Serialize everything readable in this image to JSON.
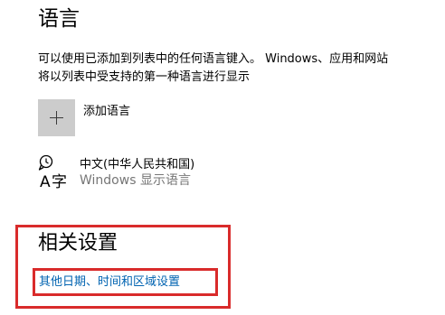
{
  "language_section": {
    "title": "语言",
    "description_line1": "可以使用已添加到列表中的任何语言键入。 Windows、应用和网站",
    "description_line2": "将以列表中受支持的第一种语言进行显示",
    "add_language_label": "添加语言",
    "add_icon": "plus-icon"
  },
  "languages": [
    {
      "name": "中文(中华人民共和国)",
      "subtitle": "Windows 显示语言",
      "icon": "language-display-icon"
    }
  ],
  "related_settings": {
    "title": "相关设置",
    "link_label": "其他日期、时间和区域设置"
  },
  "colors": {
    "highlight_border": "#d92b2b",
    "link": "#0063b1",
    "tile": "#cccccc",
    "secondary_text": "#767676"
  }
}
